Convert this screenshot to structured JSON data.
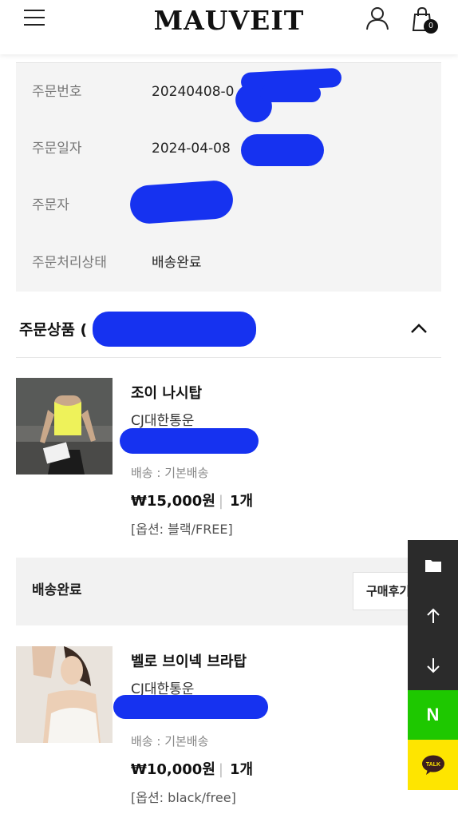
{
  "header": {
    "logo": "MAUVEIT",
    "cart_count": "0",
    "icons": [
      "menu-icon",
      "user-icon",
      "shopping-bag-icon"
    ]
  },
  "order_info": {
    "rows": [
      {
        "label": "주문번호",
        "value": "20240408-0"
      },
      {
        "label": "주문일자",
        "value": "2024-04-08"
      },
      {
        "label": "주문자",
        "value": ""
      },
      {
        "label": "주문처리상태",
        "value": "배송완료"
      }
    ]
  },
  "ordered_products": {
    "title": "주문상품 (",
    "toggle_icon": "chevron-up-icon"
  },
  "products": [
    {
      "name": "조이 나시탑",
      "carrier": "CJ대한통운",
      "shipping": "배송 : 기본배송",
      "price": "₩15,000원",
      "separator": "|",
      "quantity": "1개",
      "option": "[옵션: 블랙/FREE]"
    },
    {
      "name": "벨로 브이넥 브라탑",
      "carrier": "CJ대한통운",
      "shipping": "배송 : 기본배송",
      "price": "₩10,000원",
      "separator": "|",
      "quantity": "1개",
      "option": "[옵션: black/free]"
    }
  ],
  "status_bar": {
    "label": "배송완료",
    "review_button": "구매후기"
  },
  "float_bar": {
    "naver_label": "N",
    "talk_label": "TALK",
    "icons": [
      "folder-icon",
      "arrow-up-icon",
      "arrow-down-icon",
      "naver-icon",
      "kakaotalk-icon"
    ]
  },
  "colors": {
    "redaction": "#1632f0",
    "naver_green": "#1ec800",
    "kakao_yellow": "#fee500",
    "float_dark": "#2b2b2b"
  }
}
